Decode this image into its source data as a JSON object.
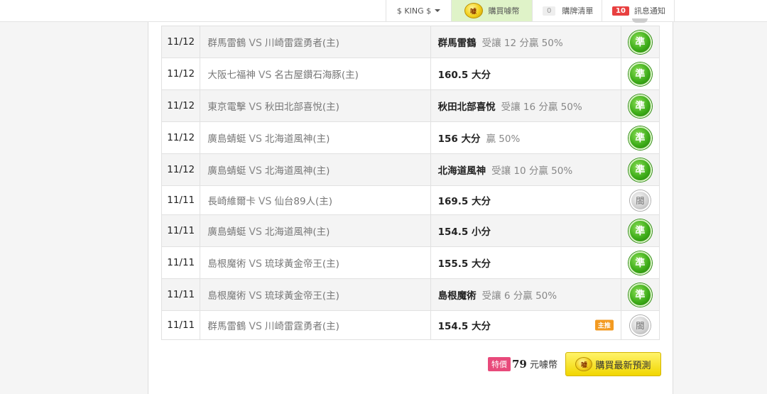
{
  "nav": {
    "user": "$ KING $",
    "buy_label": "購買噱幣",
    "coin_glyph": "噱",
    "cart_count": "0",
    "cart_label": "購牌清單",
    "msg_count": "10",
    "msg_label": "訊息通知"
  },
  "vs": "VS",
  "rows": [
    {
      "date": "11/12",
      "away": "群馬雷鶴",
      "home": "川崎雷霆勇者(主)",
      "pick": "群馬雷鶴",
      "note": "受讓 12 分贏 50%",
      "result": "準",
      "hot": ""
    },
    {
      "date": "11/12",
      "away": "大阪七福神",
      "home": "名古屋鑽石海豚(主)",
      "pick": "160.5 大分",
      "note": "",
      "result": "準",
      "hot": ""
    },
    {
      "date": "11/12",
      "away": "東京電擊",
      "home": "秋田北部喜悅(主)",
      "pick": "秋田北部喜悅",
      "note": "受讓 16 分贏 50%",
      "result": "準",
      "hot": ""
    },
    {
      "date": "11/12",
      "away": "廣島蜻蜓",
      "home": "北海道風神(主)",
      "pick": "156 大分",
      "note": "贏 50%",
      "result": "準",
      "hot": ""
    },
    {
      "date": "11/12",
      "away": "廣島蜻蜓",
      "home": "北海道風神(主)",
      "pick": "北海道風神",
      "note": "受讓 10 分贏 50%",
      "result": "準",
      "hot": ""
    },
    {
      "date": "11/11",
      "away": "長崎維爾卡",
      "home": "仙台89人(主)",
      "pick": "169.5 大分",
      "note": "",
      "result": "閤",
      "hot": ""
    },
    {
      "date": "11/11",
      "away": "廣島蜻蜓",
      "home": "北海道風神(主)",
      "pick": "154.5 小分",
      "note": "",
      "result": "準",
      "hot": ""
    },
    {
      "date": "11/11",
      "away": "島根魔術",
      "home": "琉球黃金帝王(主)",
      "pick": "155.5 大分",
      "note": "",
      "result": "準",
      "hot": ""
    },
    {
      "date": "11/11",
      "away": "島根魔術",
      "home": "琉球黃金帝王(主)",
      "pick": "島根魔術",
      "note": "受讓 6 分贏 50%",
      "result": "準",
      "hot": ""
    },
    {
      "date": "11/11",
      "away": "群馬雷鶴",
      "home": "川崎雷霆勇者(主)",
      "pick": "154.5 大分",
      "note": "",
      "result": "閤",
      "hot": "主推"
    }
  ],
  "footer": {
    "special_label": "特價",
    "price": "79",
    "unit": "元噱幣",
    "buy_button": "購買最新預測"
  },
  "colors": {
    "win_green": "#3fae1a",
    "push_gray": "#cfcfcf",
    "buy_yellow": "#f1d600",
    "hot_orange": "#f39a21",
    "special_pink": "#e84a7b"
  }
}
